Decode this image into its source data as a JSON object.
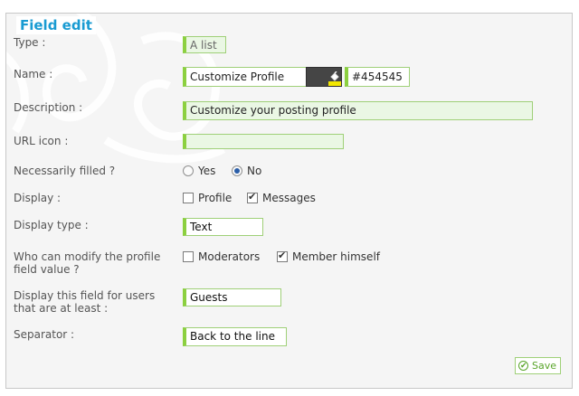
{
  "legend": "Field edit",
  "rows": {
    "type": {
      "label": "Type :",
      "value": "A list"
    },
    "name": {
      "label": "Name :",
      "value": "Customize Profile",
      "color": "#454545",
      "color_text": "#454545"
    },
    "description": {
      "label": "Description :",
      "value": "Customize your posting profile"
    },
    "url_icon": {
      "label": "URL icon :",
      "value": ""
    },
    "required": {
      "label": "Necessarily filled ?",
      "options": [
        "Yes",
        "No"
      ],
      "selected": "No"
    },
    "display": {
      "label": "Display :",
      "options": [
        "Profile",
        "Messages"
      ],
      "checked": [
        "Messages"
      ]
    },
    "display_type": {
      "label": "Display type :",
      "value": "Text"
    },
    "who_modify": {
      "label_line1": "Who can modify the profile",
      "label_line2": "field value ?",
      "options": [
        "Moderators",
        "Member himself"
      ],
      "checked": [
        "Member himself"
      ]
    },
    "display_for": {
      "label_line1": "Display this field for users",
      "label_line2": "that are at least :",
      "value": "Guests"
    },
    "separator": {
      "label": "Separator :",
      "value": "Back to the line"
    }
  },
  "save_label": "Save",
  "icons": {
    "swatch": "paint-bucket-icon",
    "save": "check-circle-icon"
  },
  "colors": {
    "accent": "#199bd2",
    "field_border": "#8cd040",
    "field_bg": "#eaf7e4"
  }
}
